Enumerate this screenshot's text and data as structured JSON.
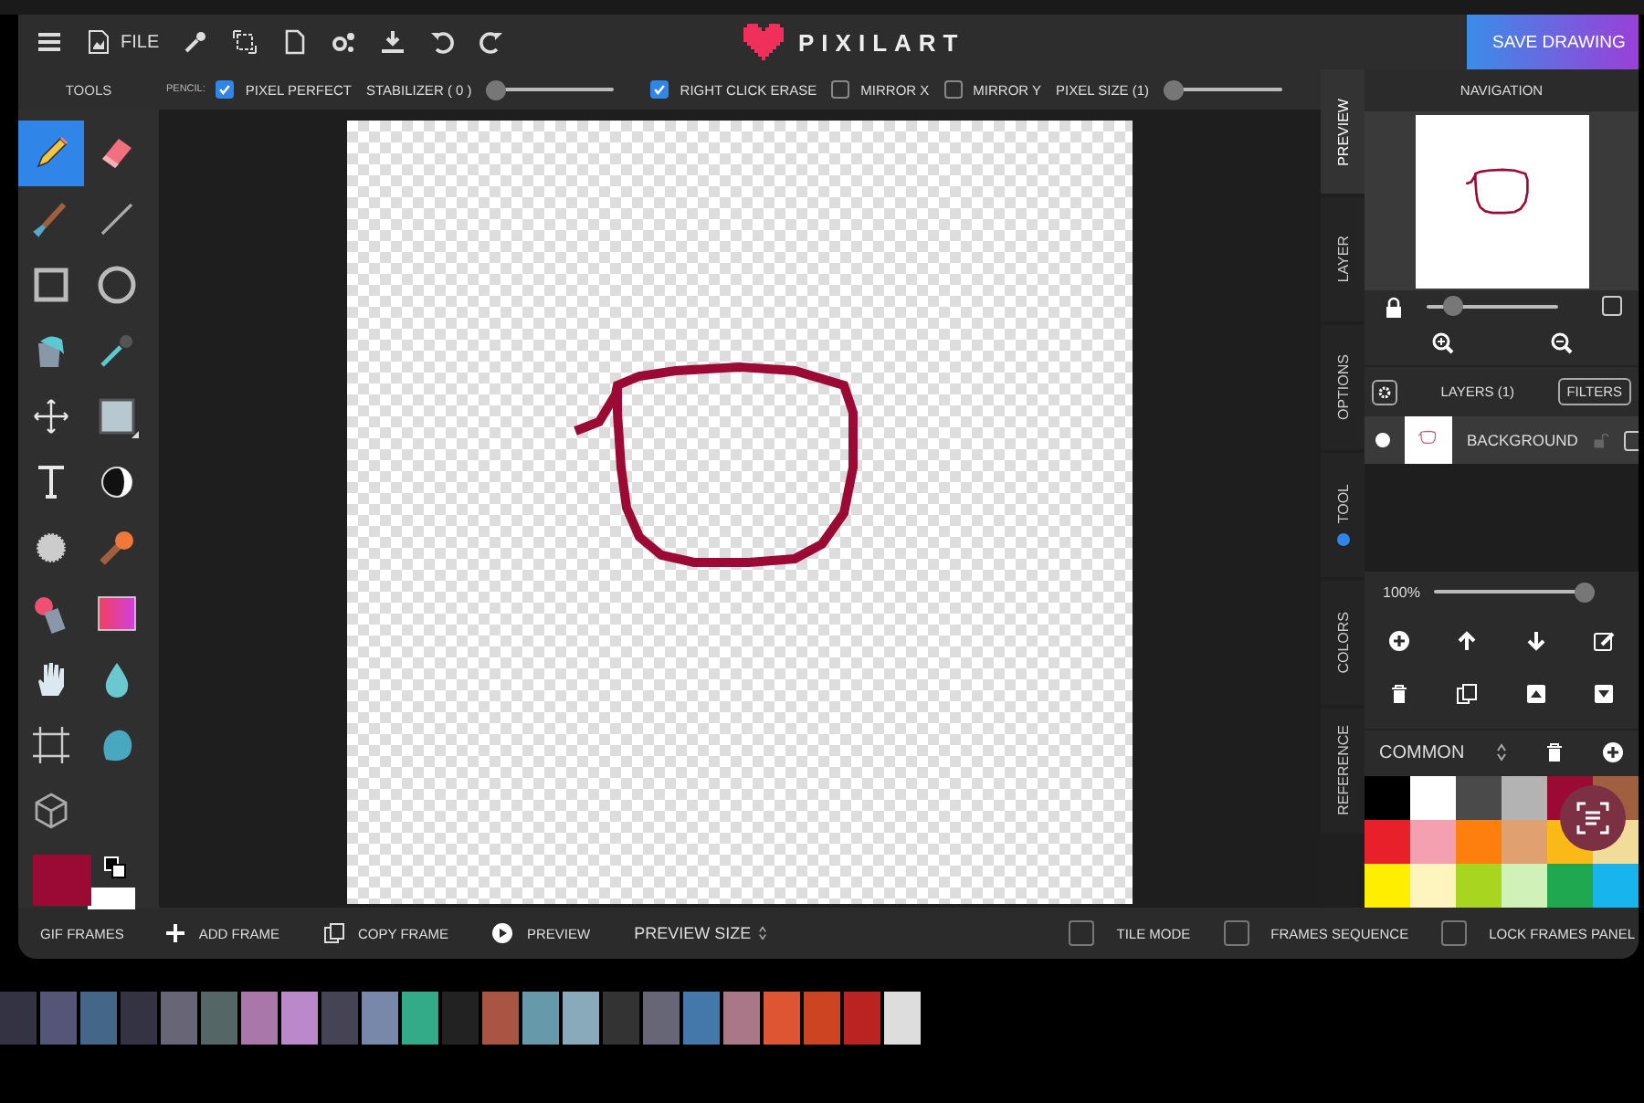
{
  "header": {
    "file_label": "FILE",
    "logo": "PIXILART",
    "save_button": "SAVE DRAWING"
  },
  "tools_label": "TOOLS",
  "tool_options": {
    "tool_name": "PENCIL:",
    "options": [
      {
        "kind": "checkbox",
        "label": "PIXEL PERFECT",
        "checked": true
      },
      {
        "kind": "slider",
        "label": "STABILIZER ( 0 )",
        "level": 0
      },
      {
        "kind": "checkbox",
        "label": "RIGHT CLICK ERASE",
        "checked": true
      },
      {
        "kind": "checkbox",
        "label": "MIRROR X",
        "checked": false
      },
      {
        "kind": "checkbox",
        "label": "MIRROR Y",
        "checked": false
      },
      {
        "kind": "slider",
        "label": "PIXEL SIZE (1)",
        "level": 0
      }
    ]
  },
  "tools": [
    {
      "kind": "pencil",
      "selected": true
    },
    {
      "kind": "eraser",
      "selected": false
    },
    {
      "kind": "brush",
      "selected": false
    },
    {
      "kind": "line",
      "selected": false
    },
    {
      "kind": "rectangle",
      "selected": false
    },
    {
      "kind": "ellipse",
      "selected": false
    },
    {
      "kind": "bucket",
      "selected": false
    },
    {
      "kind": "eyedropper",
      "selected": false
    },
    {
      "kind": "move",
      "selected": false
    },
    {
      "kind": "selection",
      "selected": false
    },
    {
      "kind": "text",
      "selected": false
    },
    {
      "kind": "lighten",
      "selected": false
    },
    {
      "kind": "dither",
      "selected": false
    },
    {
      "kind": "stamp",
      "selected": false
    },
    {
      "kind": "spray",
      "selected": false
    },
    {
      "kind": "gradient",
      "selected": false
    },
    {
      "kind": "hand",
      "selected": false
    },
    {
      "kind": "drop",
      "selected": false
    },
    {
      "kind": "crop",
      "selected": false
    },
    {
      "kind": "smudge",
      "selected": false
    },
    {
      "kind": "cube",
      "selected": false
    }
  ],
  "colors": {
    "primary": {
      "color": "#9b0a35"
    },
    "secondary": {
      "color": "#ffffff"
    }
  },
  "side_tabs": [
    {
      "label": "PREVIEW",
      "selected": true,
      "notified": false
    },
    {
      "label": "LAYER",
      "selected": false,
      "notified": false
    },
    {
      "label": "OPTIONS",
      "selected": false,
      "notified": false
    },
    {
      "label": "TOOL",
      "selected": false,
      "notified": true
    },
    {
      "label": "COLORS",
      "selected": false,
      "notified": false
    },
    {
      "label": "REFERENCE",
      "selected": false,
      "notified": false
    }
  ],
  "navigation": {
    "title": "NAVIGATION",
    "zoom_slider": {
      "level": 0.15
    },
    "fit_checked": false
  },
  "layers": {
    "title": "LAYERS (1)",
    "filters_button": "FILTERS",
    "items": [
      {
        "name": "BACKGROUND",
        "visible": true,
        "checked": false
      }
    ],
    "opacity": "100%",
    "opacity_slider": {
      "level": 1
    }
  },
  "palette": {
    "name": "COMMON",
    "swatches": [
      {
        "color": "#000000"
      },
      {
        "color": "#ffffff"
      },
      {
        "color": "#4a4a4a"
      },
      {
        "color": "#b3b3b3"
      },
      {
        "color": "#9b0a35"
      },
      {
        "color": "#a0603f"
      },
      {
        "color": "#e8202a"
      },
      {
        "color": "#f5a0b0"
      },
      {
        "color": "#ff7f0e"
      },
      {
        "color": "#e0a070"
      },
      {
        "color": "#fbb917"
      },
      {
        "color": "#f2dc9a"
      },
      {
        "color": "#ffee00"
      },
      {
        "color": "#fdf5bd"
      },
      {
        "color": "#a8d620"
      },
      {
        "color": "#d0f2b8"
      },
      {
        "color": "#20a850"
      },
      {
        "color": "#18b4ee"
      }
    ]
  },
  "bottom_bar": {
    "title": "GIF FRAMES",
    "actions": [
      {
        "kind": "add",
        "label": "ADD FRAME"
      },
      {
        "kind": "copy",
        "label": "COPY FRAME"
      },
      {
        "kind": "play",
        "label": "PREVIEW"
      }
    ],
    "preview_size": "PREVIEW SIZE",
    "toggles": [
      {
        "label": "TILE MODE",
        "checked": false
      },
      {
        "label": "FRAMES SEQUENCE",
        "checked": false
      },
      {
        "label": "LOCK FRAMES PANEL",
        "checked": false
      }
    ]
  }
}
